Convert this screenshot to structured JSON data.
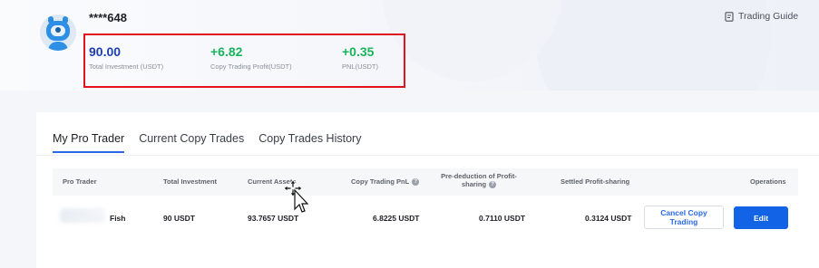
{
  "user": {
    "masked_id": "****648"
  },
  "header": {
    "trading_guide": "Trading Guide"
  },
  "stats": [
    {
      "value": "90.00",
      "label": "Total Investment (USDT)"
    },
    {
      "value": "+6.82",
      "label": "Copy Trading Profit(USDT)"
    },
    {
      "value": "+0.35",
      "label": "PNL(USDT)"
    }
  ],
  "tabs": [
    {
      "label": "My Pro Trader",
      "active": true
    },
    {
      "label": "Current Copy Trades",
      "active": false
    },
    {
      "label": "Copy Trades History",
      "active": false
    }
  ],
  "table": {
    "headers": {
      "pro_trader": "Pro Trader",
      "total_investment": "Total Investment",
      "current_assets": "Current Assets",
      "copy_pnl": "Copy Trading PnL",
      "pre_deduction": "Pre-deduction of Profit-sharing",
      "settled": "Settled Profit-sharing",
      "operations": "Operations"
    },
    "rows": [
      {
        "trader": "Fish",
        "total_investment": "90 USDT",
        "current_assets": "93.7657 USDT",
        "copy_pnl": "6.8225 USDT",
        "pre_deduction": "0.7110 USDT",
        "settled": "0.3124 USDT",
        "cancel_label": "Cancel Copy Trading",
        "edit_label": "Edit"
      }
    ]
  },
  "colors": {
    "accent": "#1363e6",
    "profit": "#19b45c",
    "highlight_border": "#e0141c"
  },
  "icons": [
    "robot-avatar",
    "document-icon",
    "help-icon",
    "move-cursor-icon"
  ]
}
